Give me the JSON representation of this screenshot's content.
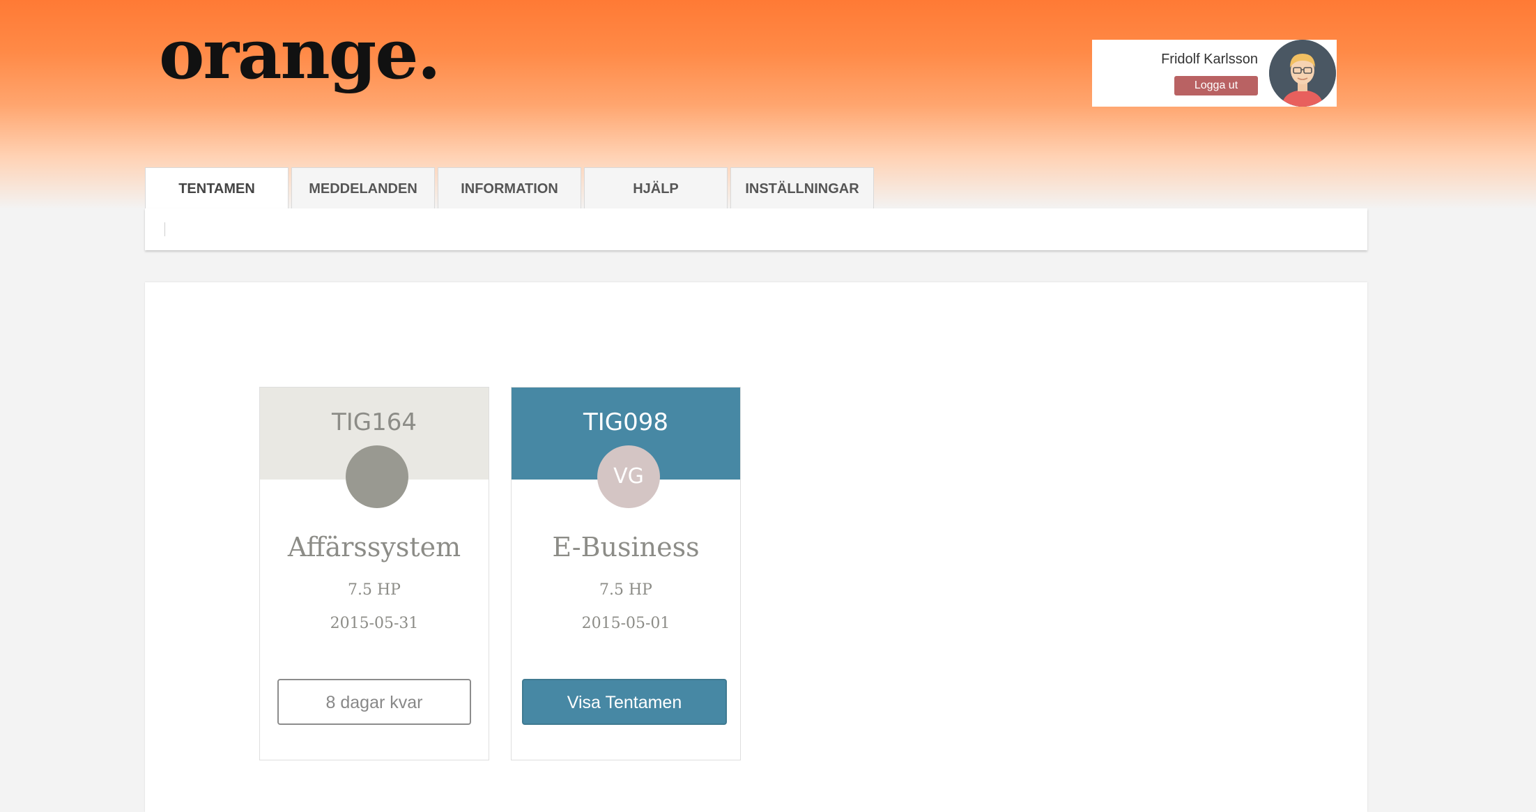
{
  "app": {
    "logo_text": "orange."
  },
  "user": {
    "name": "Fridolf Karlsson",
    "logout_label": "Logga ut"
  },
  "tabs": [
    {
      "label": "TENTAMEN",
      "active": true
    },
    {
      "label": "MEDDELANDEN",
      "active": false
    },
    {
      "label": "INFORMATION",
      "active": false
    },
    {
      "label": "HJÄLP",
      "active": false
    },
    {
      "label": "INSTÄLLNINGAR",
      "active": false
    }
  ],
  "exams": [
    {
      "code": "TIG164",
      "badge_text": "",
      "title": "Affärssystem",
      "credits": "7.5 HP",
      "date": "2015-05-31",
      "action_label": "8 dagar kvar",
      "header_color": "#e9e8e3",
      "code_color": "#8c8c87",
      "badge_color": "#999991"
    },
    {
      "code": "TIG098",
      "badge_text": "VG",
      "title": "E-Business",
      "credits": "7.5 HP",
      "date": "2015-05-01",
      "action_label": "Visa Tentamen",
      "header_color": "#4788a4",
      "code_color": "#ffffff",
      "badge_color": "#d4c5c4"
    }
  ],
  "colors": {
    "header_gradient_top": "#ff7a35",
    "logout_button": "#b96263",
    "primary_button": "#4788a4",
    "page_background": "#f3f3f3"
  },
  "icons": {
    "avatar": "user-avatar-icon"
  }
}
